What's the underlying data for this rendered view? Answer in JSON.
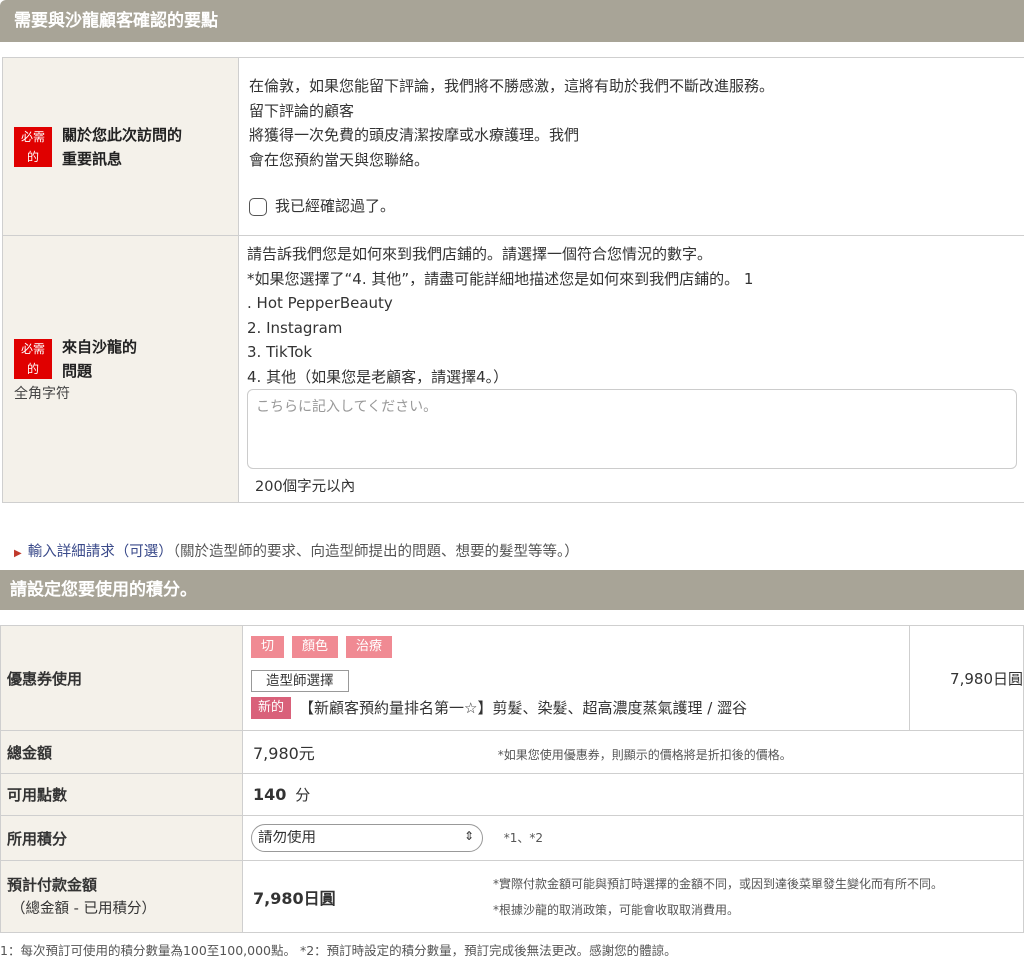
{
  "section1": {
    "header": "需要與沙龍顧客確認的要點",
    "row1": {
      "required": "必需\n的",
      "label_line1": "關於您此次訪問的",
      "label_line2": "重要訊息",
      "lines": [
        "在倫敦，如果您能留下評論，我們將不勝感激，這將有助於我們不斷改進服務。",
        "留下評論的顧客",
        "將獲得一次免費的頭皮清潔按摩或水療護理。我們",
        "會在您預約當天與您聯絡。"
      ],
      "checkbox_label": "我已經確認過了。"
    },
    "row2": {
      "required": "必需\n的",
      "label_line1": "來自沙龍的",
      "label_line2": "問題",
      "note": "全角字符",
      "lines": [
        "請告訴我們您是如何來到我們店鋪的。請選擇一個符合您情況的數字。",
        "*如果您選擇了“4. 其他”，請盡可能詳細地描述您是如何來到我們店鋪的。 1",
        ". Hot PepperBeauty",
        "2. Instagram",
        "3. TikTok",
        "4. 其他（如果您是老顧客，請選擇4。）"
      ],
      "placeholder": "こちらに記入してください。",
      "limit": "200個字元以內"
    }
  },
  "detail": {
    "link": "輸入詳細請求（可選）",
    "desc": "（關於造型師的要求、向造型師提出的問題、想要的髮型等等。）"
  },
  "section2": {
    "header": "請設定您要使用的積分。",
    "coupon": {
      "label": "優惠券使用",
      "tags": [
        "切",
        "顏色",
        "治療"
      ],
      "stylist": "造型師選擇",
      "new": "新的",
      "name": "【新顧客預約量排名第一☆】剪髮、染髮、超高濃度蒸氣護理 / 澀谷",
      "price": "7,980日圓"
    },
    "total": {
      "label": "總金額",
      "value": "7,980元",
      "note": "*如果您使用優惠券，則顯示的價格將是折扣後的價格。"
    },
    "points": {
      "label": "可用點數",
      "value": "140",
      "unit": "分"
    },
    "used": {
      "label": "所用積分",
      "selected": "請勿使用",
      "note": "*1、*2"
    },
    "estimated": {
      "label": "預計付款金額",
      "sublabel": "（總金額 - 已用積分）",
      "value": "7,980日圓",
      "note1": "*實際付款金額可能與預訂時選擇的金額不同，或因到達後菜單發生變化而有所不同。",
      "note2": "*根據沙龍的取消政策，可能會收取取消費用。"
    }
  },
  "footer": "1：每次預訂可使用的積分數量為100至100,000點。 *2：預訂時設定的積分數量，預訂完成後無法更改。感謝您的體諒。"
}
